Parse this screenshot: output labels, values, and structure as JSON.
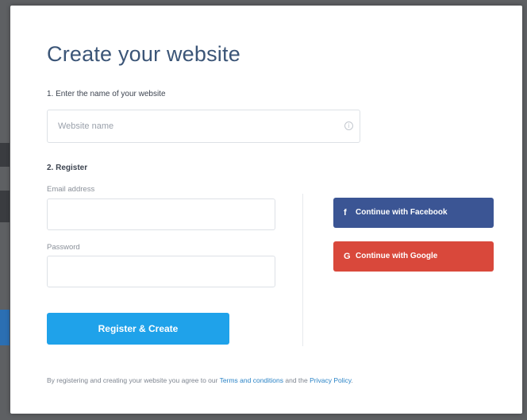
{
  "modal": {
    "title": "Create your website",
    "step1_label": "1. Enter the name of your website",
    "website_placeholder": "Website name",
    "info_icon": "info-icon",
    "step2_label": "2. Register",
    "email_label": "Email address",
    "password_label": "Password",
    "register_button": "Register & Create",
    "facebook_button": "Continue with Facebook",
    "facebook_icon": "facebook-icon",
    "google_button": "Continue with Google",
    "google_icon": "google-icon",
    "terms": {
      "prefix": "By registering and creating your website you agree to our ",
      "terms_link": "Terms and conditions",
      "middle": " and the ",
      "privacy_link": "Privacy Policy",
      "suffix": "."
    }
  },
  "colors": {
    "title": "#3b5577",
    "primary_button": "#1fa2ea",
    "facebook": "#3b5594",
    "google": "#d9483b",
    "link": "#2a83c6"
  }
}
